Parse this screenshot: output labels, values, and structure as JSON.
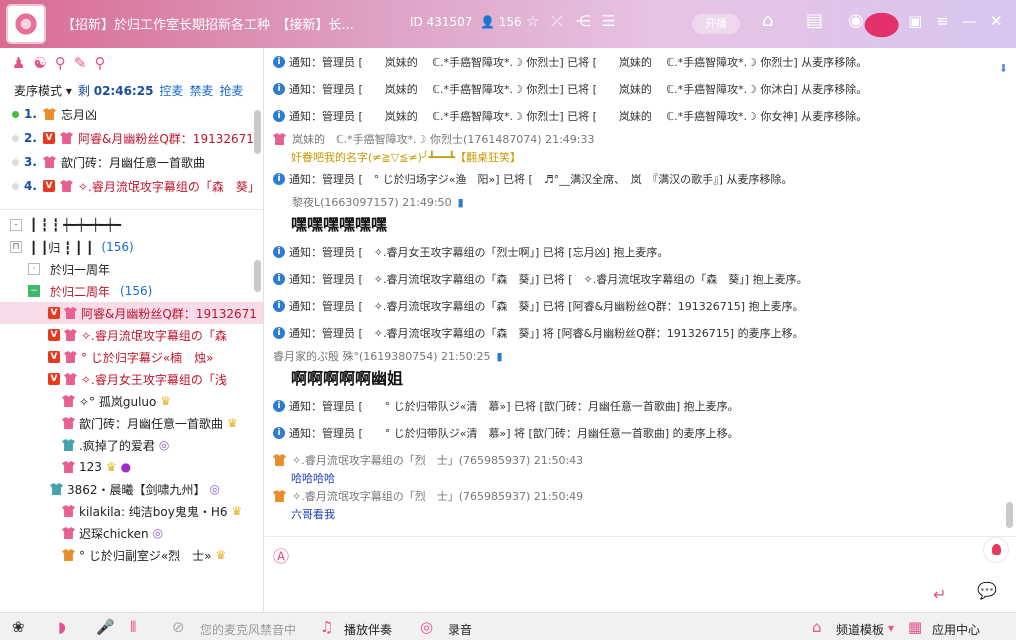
{
  "window": {
    "title": "【招新】於归工作室长期招新各工种　【接新】长...",
    "id_label": "ID 431507",
    "users_label": "156",
    "open_label": "开播"
  },
  "queue": {
    "mode_label": "麦序模式",
    "remain_label": "剩",
    "remain_time": "02:46:25",
    "control_label": "控麦",
    "ban_label": "禁麦",
    "grab_label": "抢麦",
    "items": [
      {
        "num": "1.",
        "name": "忘月凶"
      },
      {
        "num": "2.",
        "name": "阿睿&月幽粉丝Q群：191326715"
      },
      {
        "num": "3.",
        "name": "歆门砖：月幽任意一首歌曲"
      },
      {
        "num": "4.",
        "name": "✧.睿月流氓攻字幕组の「森　葵」"
      }
    ]
  },
  "tree": {
    "top_label": "┃ ┇ ┇ ┿━┿━┿━┿━",
    "channel_label": "┃ ┃归 ┇ ┃ ┃",
    "channel_count": "(156)",
    "sub1": "於归一周年",
    "sub2": "於归二周年",
    "sub2_count": "(156)",
    "users": [
      "阿睿&月幽粉丝Q群：19132671",
      "✧.睿月流氓攻字幕组の「森",
      "° じ於归字幕ジ«楠　烛»",
      "✧.睿月女王攻字幕组の「浅",
      "✧° 孤岚guluo",
      "歆门砖：月幽任意一首歌曲",
      ".疯掉了的爱君",
      "123",
      "3862・晨曦【剑啸九州】",
      "kilakila: 纯洁boy鬼鬼・H6",
      "迟琛chicken",
      "° じ於归副室ジ«烈　士»"
    ]
  },
  "chat": {
    "messages": [
      {
        "type": "notice",
        "text": "通知：管理员 [　　岚妹的　 ℂ.*手癌智障攻*.☽ 你烈士] 已将 [　　岚妹的　 ℂ.*手癌智障攻*.☽ 你烈士] 从麦序移除。"
      },
      {
        "type": "notice",
        "text": "通知：管理员 [　　岚妹的　 ℂ.*手癌智障攻*.☽ 你烈士] 已将 [　　岚妹的　 ℂ.*手癌智障攻*.☽ 你沐白] 从麦序移除。"
      },
      {
        "type": "notice",
        "text": "通知：管理员 [　　岚妹的　 ℂ.*手癌智障攻*.☽ 你烈士] 已将 [　　岚妹的　 ℂ.*手癌智障攻*.☽ 你女神] 从麦序移除。"
      },
      {
        "type": "speaker",
        "name": "岚妹的　ℂ.*手癌智障攻*.☽ 你烈士(1761487074) 21:49:33"
      },
      {
        "type": "line",
        "text": "奸眷吧我的名字(≠≧▽≦≠)╯┻━━┻【翻桌狂笑】"
      },
      {
        "type": "notice",
        "text": "通知：管理员 [　° じ於归场字ジ«渔　阳»] 已将 [　♬°__满汉全席、　岚　『满汉の歌手』] 从麦序移除。"
      },
      {
        "type": "speaker",
        "name": "黎夜L(1663097157) 21:49:50"
      },
      {
        "type": "big",
        "text": "嘿嘿嘿嘿嘿嘿"
      },
      {
        "type": "notice",
        "text": "通知：管理员 [　✧.睿月女王攻字幕组の「烈士啊」] 已将 [忘月凶] 抱上麦序。"
      },
      {
        "type": "notice",
        "text": "通知：管理员 [　✧.睿月流氓攻字幕组の「森　葵」] 已将 [　✧.睿月流氓攻字幕组の「森　葵」] 抱上麦序。"
      },
      {
        "type": "notice",
        "text": "通知：管理员 [　✧.睿月流氓攻字幕组の「森　葵」] 已将 [阿睿&月幽粉丝Q群：191326715] 抱上麦序。"
      },
      {
        "type": "notice",
        "text": "通知：管理员 [　✧.睿月流氓攻字幕组の「森　葵」] 将 [阿睿&月幽粉丝Q群：191326715] 的麦序上移。"
      },
      {
        "type": "speaker",
        "name": "睿月家的ぷ殷 殊°(1619380754) 21:50:25"
      },
      {
        "type": "big",
        "text": "啊啊啊啊啊幽姐"
      },
      {
        "type": "notice",
        "text": "通知：管理员 [　　° じ於归带队ジ«清　慕»] 已将 [歆门砖：月幽任意一首歌曲] 抱上麦序。"
      },
      {
        "type": "notice",
        "text": "通知：管理员 [　　° じ於归带队ジ«清　慕»] 将 [歆门砖：月幽任意一首歌曲] 的麦序上移。"
      },
      {
        "type": "speaker",
        "name": "✧.睿月流氓攻字幕组の「烈　士」(765985937) 21:50:43"
      },
      {
        "type": "line2",
        "text": "哈哈哈哈"
      },
      {
        "type": "speaker",
        "name": "✧.睿月流氓攻字幕组の「烈　士」(765985937) 21:50:49"
      },
      {
        "type": "line2",
        "text": "六哥看我"
      }
    ]
  },
  "bottom": {
    "mic_status": "您的麦克风禁音中",
    "accompany_label": "播放伴奏",
    "record_label": "录音",
    "template_label": "频道模板",
    "apps_label": "应用中心"
  },
  "colors": {
    "accent": "#e4528e",
    "notice_icon": "#2d7ccf",
    "admin_red": "#c0152d",
    "link_blue": "#1a6bd0"
  }
}
